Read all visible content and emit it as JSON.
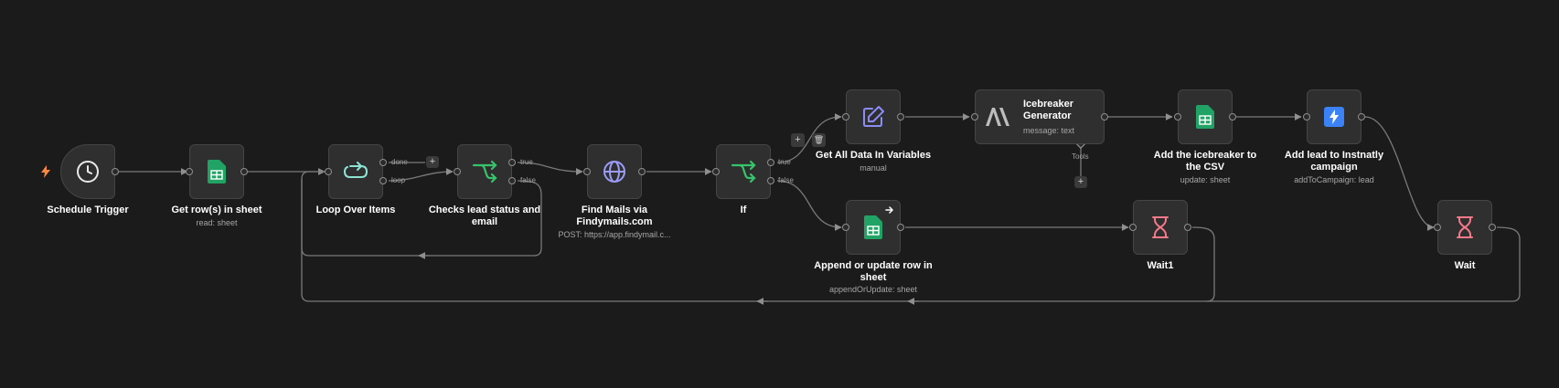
{
  "nodes": {
    "schedule_trigger": {
      "label": "Schedule Trigger"
    },
    "get_rows": {
      "label": "Get row(s) in sheet",
      "subtitle": "read: sheet"
    },
    "loop_over_items": {
      "label": "Loop Over Items",
      "done": "done",
      "loop": "loop"
    },
    "checks_lead": {
      "label": "Checks lead status and email",
      "true": "true",
      "false": "false"
    },
    "find_mails": {
      "label": "Find Mails via Findymails.com",
      "subtitle": "POST: https://app.findymail.c..."
    },
    "if_node": {
      "label": "If",
      "true": "true",
      "false": "false"
    },
    "get_all_data": {
      "label": "Get All Data In Variables",
      "subtitle": "manual"
    },
    "icebreaker": {
      "label": "Icebreaker Generator",
      "subtitle": "message: text",
      "tools": "Tools"
    },
    "add_icebreaker": {
      "label": "Add the icebreaker to the CSV",
      "subtitle": "update: sheet"
    },
    "add_lead": {
      "label": "Add lead to Instnatly campaign",
      "subtitle": "addToCampaign: lead"
    },
    "append_update": {
      "label": "Append or update row in sheet",
      "subtitle": "appendOrUpdate: sheet"
    },
    "wait1": {
      "label": "Wait1"
    },
    "wait": {
      "label": "Wait"
    }
  },
  "controls": {
    "plus": "+",
    "trash": "🗑"
  },
  "colors": {
    "background": "#1b1b1b",
    "node": "#2f2f2f",
    "sheets_green": "#21a366",
    "loop_teal": "#8ee4d4",
    "if_green": "#36c46b",
    "edit_purple": "#8b8cf5",
    "globe_purple": "#9b9cf8",
    "wait_pink": "#f47a8a",
    "instantly_blue": "#3b82f6",
    "trigger_orange": "#ff8a3d"
  },
  "icons": [
    "bolt-icon",
    "clock-icon",
    "google-sheets-icon",
    "loop-icon",
    "if-branch-icon",
    "globe-icon",
    "edit-icon",
    "anthropic-icon",
    "instantly-icon",
    "hourglass-icon",
    "arrow-right-icon"
  ]
}
